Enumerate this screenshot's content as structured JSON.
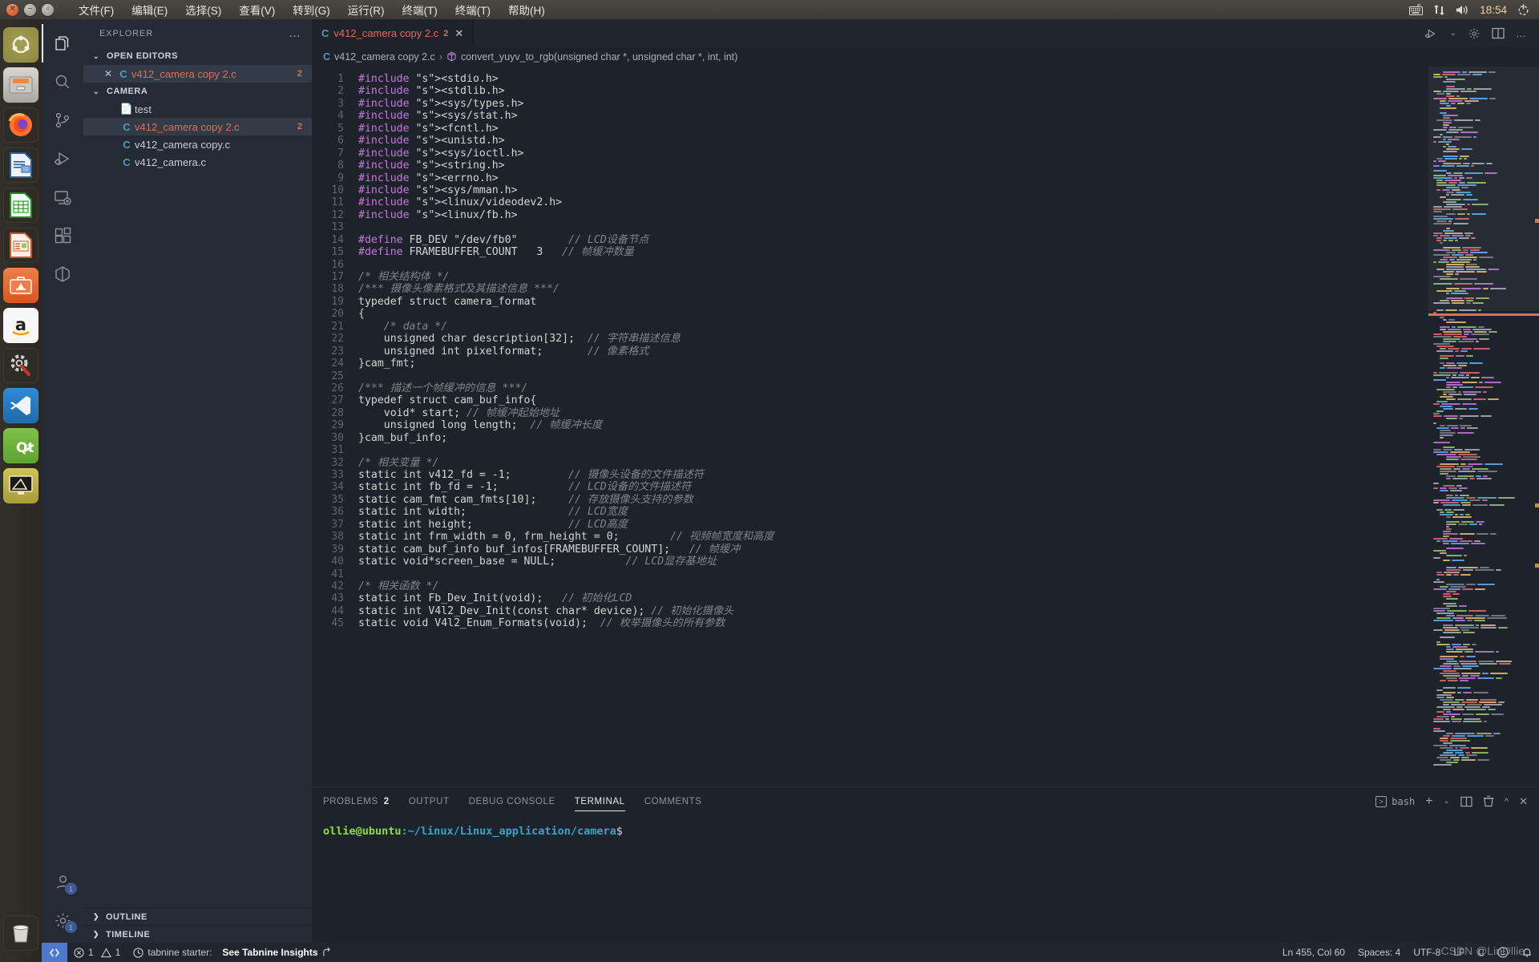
{
  "topbar": {
    "window_buttons": [
      "close",
      "minimize",
      "maximize"
    ],
    "menus": [
      "文件(F)",
      "编辑(E)",
      "选择(S)",
      "查看(V)",
      "转到(G)",
      "运行(R)",
      "终端(T)",
      "终端(T)",
      "帮助(H)"
    ],
    "tray_icons": [
      "keyboard-icon",
      "network-icon",
      "volume-icon",
      "power-icon"
    ],
    "clock": "18:54"
  },
  "dock": {
    "items": [
      {
        "name": "ubuntu-software",
        "glyph": "◎"
      },
      {
        "name": "files",
        "glyph": "🗄"
      },
      {
        "name": "firefox",
        "glyph": "🦊"
      },
      {
        "name": "libreoffice-writer",
        "glyph": "📄"
      },
      {
        "name": "libreoffice-calc",
        "glyph": "📊"
      },
      {
        "name": "libreoffice-impress",
        "glyph": "📽"
      },
      {
        "name": "ubuntu-software-center",
        "glyph": "A"
      },
      {
        "name": "amazon",
        "glyph": "a"
      },
      {
        "name": "system-settings",
        "glyph": "⚙"
      },
      {
        "name": "visual-studio-code",
        "glyph": "VS"
      },
      {
        "name": "qt-creator",
        "glyph": "Qt"
      },
      {
        "name": "screen-tool",
        "glyph": "🖥"
      }
    ],
    "trash": "trash-icon"
  },
  "activitybar": {
    "items": [
      {
        "name": "explorer",
        "active": true,
        "badge": null
      },
      {
        "name": "search",
        "active": false,
        "badge": null
      },
      {
        "name": "source-control",
        "active": false,
        "badge": null
      },
      {
        "name": "run-and-debug",
        "active": false,
        "badge": null
      },
      {
        "name": "remote-explorer",
        "active": false,
        "badge": null
      },
      {
        "name": "extensions",
        "active": false,
        "badge": null
      },
      {
        "name": "docker",
        "active": false,
        "badge": null
      }
    ],
    "bottom": [
      {
        "name": "accounts",
        "badge": "1"
      },
      {
        "name": "manage-settings",
        "badge": "1"
      }
    ]
  },
  "sidebar": {
    "title": "EXPLORER",
    "more_actions": "…",
    "open_editors": {
      "label": "OPEN EDITORS",
      "expanded": true,
      "items": [
        {
          "icon": "c-file-icon",
          "name": "v412_camera copy 2.c",
          "badge": "2",
          "selected": true,
          "modified": true
        }
      ]
    },
    "folder": {
      "label": "CAMERA",
      "expanded": true,
      "items": [
        {
          "icon": "plain-file-icon",
          "name": "test",
          "badge": "",
          "selected": false,
          "modified": false
        },
        {
          "icon": "c-file-icon",
          "name": "v412_camera copy 2.c",
          "badge": "2",
          "selected": true,
          "modified": true
        },
        {
          "icon": "c-file-icon",
          "name": "v412_camera copy.c",
          "badge": "",
          "selected": false,
          "modified": false
        },
        {
          "icon": "c-file-icon",
          "name": "v412_camera.c",
          "badge": "",
          "selected": false,
          "modified": false
        }
      ]
    },
    "footer_sections": [
      {
        "label": "OUTLINE",
        "expanded": false
      },
      {
        "label": "TIMELINE",
        "expanded": false
      }
    ]
  },
  "editor": {
    "tabs": [
      {
        "icon": "c-file-icon",
        "label": "v412_camera copy 2.c",
        "badge": "2",
        "active": true,
        "close": "✕"
      }
    ],
    "actions": [
      "run-debug-icon",
      "split-editor-icon",
      "settings-gear-icon",
      "more-actions-icon"
    ],
    "breadcrumb": {
      "file_icon": "c-file-icon",
      "file": "v412_camera copy 2.c",
      "separator": "›",
      "symbol_icon": "method-symbol-icon",
      "symbol": "convert_yuyv_to_rgb(unsigned char *, unsigned char *, int, int)"
    },
    "first_line": 1,
    "code_lines": [
      {
        "n": 1,
        "t": "#include <stdio.h>"
      },
      {
        "n": 2,
        "t": "#include <stdlib.h>"
      },
      {
        "n": 3,
        "t": "#include <sys/types.h>"
      },
      {
        "n": 4,
        "t": "#include <sys/stat.h>"
      },
      {
        "n": 5,
        "t": "#include <fcntl.h>"
      },
      {
        "n": 6,
        "t": "#include <unistd.h>"
      },
      {
        "n": 7,
        "t": "#include <sys/ioctl.h>"
      },
      {
        "n": 8,
        "t": "#include <string.h>"
      },
      {
        "n": 9,
        "t": "#include <errno.h>"
      },
      {
        "n": 10,
        "t": "#include <sys/mman.h>"
      },
      {
        "n": 11,
        "t": "#include <linux/videodev2.h>"
      },
      {
        "n": 12,
        "t": "#include <linux/fb.h>"
      },
      {
        "n": 13,
        "t": ""
      },
      {
        "n": 14,
        "t": "#define FB_DEV \"/dev/fb0\"        // LCD设备节点"
      },
      {
        "n": 15,
        "t": "#define FRAMEBUFFER_COUNT   3   // 帧缓冲数量"
      },
      {
        "n": 16,
        "t": ""
      },
      {
        "n": 17,
        "t": "/* 相关结构体 */"
      },
      {
        "n": 18,
        "t": "/*** 摄像头像素格式及其描述信息 ***/"
      },
      {
        "n": 19,
        "t": "typedef struct camera_format"
      },
      {
        "n": 20,
        "t": "{"
      },
      {
        "n": 21,
        "t": "    /* data */"
      },
      {
        "n": 22,
        "t": "    unsigned char description[32];  // 字符串描述信息"
      },
      {
        "n": 23,
        "t": "    unsigned int pixelformat;       // 像素格式"
      },
      {
        "n": 24,
        "t": "}cam_fmt;"
      },
      {
        "n": 25,
        "t": ""
      },
      {
        "n": 26,
        "t": "/*** 描述一个帧缓冲的信息 ***/"
      },
      {
        "n": 27,
        "t": "typedef struct cam_buf_info{"
      },
      {
        "n": 28,
        "t": "    void* start; // 帧缓冲起始地址"
      },
      {
        "n": 29,
        "t": "    unsigned long length;  // 帧缓冲长度"
      },
      {
        "n": 30,
        "t": "}cam_buf_info;"
      },
      {
        "n": 31,
        "t": ""
      },
      {
        "n": 32,
        "t": "/* 相关变量 */"
      },
      {
        "n": 33,
        "t": "static int v412_fd = -1;         // 摄像头设备的文件描述符"
      },
      {
        "n": 34,
        "t": "static int fb_fd = -1;           // LCD设备的文件描述符"
      },
      {
        "n": 35,
        "t": "static cam_fmt cam_fmts[10];     // 存放摄像头支持的参数"
      },
      {
        "n": 36,
        "t": "static int width;                // LCD宽度"
      },
      {
        "n": 37,
        "t": "static int height;               // LCD高度"
      },
      {
        "n": 38,
        "t": "static int frm_width = 0, frm_height = 0;        // 视频帧宽度和高度"
      },
      {
        "n": 39,
        "t": "static cam_buf_info buf_infos[FRAMEBUFFER_COUNT];   // 帧缓冲"
      },
      {
        "n": 40,
        "t": "static void*screen_base = NULL;           // LCD显存基地址"
      },
      {
        "n": 41,
        "t": ""
      },
      {
        "n": 42,
        "t": "/* 相关函数 */"
      },
      {
        "n": 43,
        "t": "static int Fb_Dev_Init(void);   // 初始化LCD"
      },
      {
        "n": 44,
        "t": "static int V4l2_Dev_Init(const char* device); // 初始化摄像头"
      },
      {
        "n": 45,
        "t": "static void V4l2_Enum_Formats(void);  // 枚举摄像头的所有参数"
      }
    ]
  },
  "panel": {
    "tabs": [
      {
        "label": "PROBLEMS",
        "count": "2",
        "active": false
      },
      {
        "label": "OUTPUT",
        "count": "",
        "active": false
      },
      {
        "label": "DEBUG CONSOLE",
        "count": "",
        "active": false
      },
      {
        "label": "TERMINAL",
        "count": "",
        "active": true
      },
      {
        "label": "COMMENTS",
        "count": "",
        "active": false
      }
    ],
    "actions": {
      "shell_label": "bash",
      "icons": [
        "new-terminal-icon",
        "chevron-down-icon",
        "split-terminal-icon",
        "kill-terminal-icon",
        "maximize-panel-icon",
        "close-panel-icon"
      ]
    },
    "terminal": {
      "user_host": "ollie@ubuntu",
      "path": ":~/linux/Linux_application/camera",
      "prompt": "$"
    }
  },
  "statusbar": {
    "remote_icon": "remote-window-icon",
    "errors": "1",
    "warnings": "1",
    "tabnine_label": "tabnine starter:",
    "tabnine_link": "See Tabnine Insights",
    "position": "Ln 455, Col 60",
    "indent": "Spaces: 4",
    "encoding": "UTF-8",
    "eol": "LF",
    "language": "C",
    "feedback_icon": "smiley-icon",
    "bell_icon": "bell-icon"
  },
  "watermark": "CSDN @LinOllie"
}
